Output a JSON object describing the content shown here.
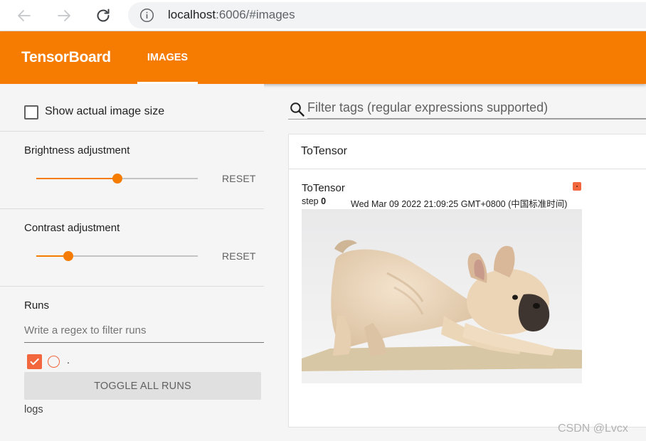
{
  "browser": {
    "url_host": "localhost",
    "url_rest": ":6006/#images"
  },
  "header": {
    "logo": "TensorBoard",
    "active_tab": "IMAGES"
  },
  "sidebar": {
    "show_actual_size_label": "Show actual image size",
    "show_actual_size_checked": false,
    "brightness": {
      "label": "Brightness adjustment",
      "value_fraction": 0.5,
      "reset_label": "RESET"
    },
    "contrast": {
      "label": "Contrast adjustment",
      "value_fraction": 0.2,
      "reset_label": "RESET"
    },
    "runs": {
      "title": "Runs",
      "filter_placeholder": "Write a regex to filter runs",
      "items": [
        {
          "name": ".",
          "checked": true,
          "color": "#f2673d"
        }
      ],
      "toggle_all_label": "TOGGLE ALL RUNS",
      "log_dir": "logs"
    }
  },
  "main": {
    "filter_placeholder": "Filter tags (regular expressions supported)",
    "category_title": "ToTensor",
    "card": {
      "title": "ToTensor",
      "step_label": "step",
      "step_value": "0",
      "timestamp": "Wed Mar 09 2022 21:09:25 GMT+0800 (中国标准时间)"
    }
  },
  "watermark": "CSDN @Lvcx",
  "colors": {
    "accent": "#f57c00",
    "run_color": "#f2673d"
  }
}
